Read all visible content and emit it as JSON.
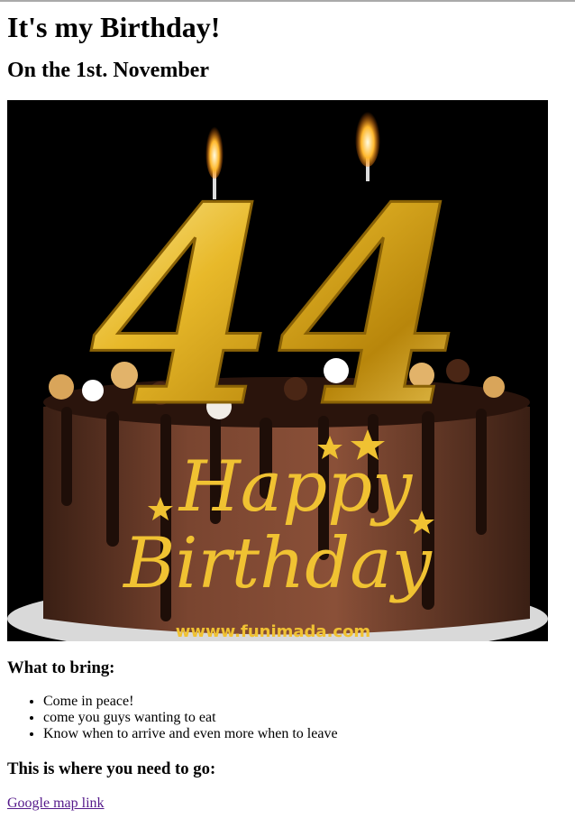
{
  "header": {
    "title": "It's my Birthday!",
    "date": "On the 1st. November"
  },
  "image": {
    "age": "44",
    "greeting_line1": "Happy",
    "greeting_line2": "Birthday",
    "watermark": "wwww.funimada.com",
    "colors": {
      "background": "#000000",
      "gold": "#e6b422",
      "cake": "#6b3a2a"
    }
  },
  "bring": {
    "heading": "What to bring:",
    "items": [
      "Come in peace!",
      "come you guys wanting to eat",
      "Know when to arrive and even more when to leave"
    ]
  },
  "location": {
    "heading": "This is where you need to go:",
    "link_text": "Google map link"
  }
}
